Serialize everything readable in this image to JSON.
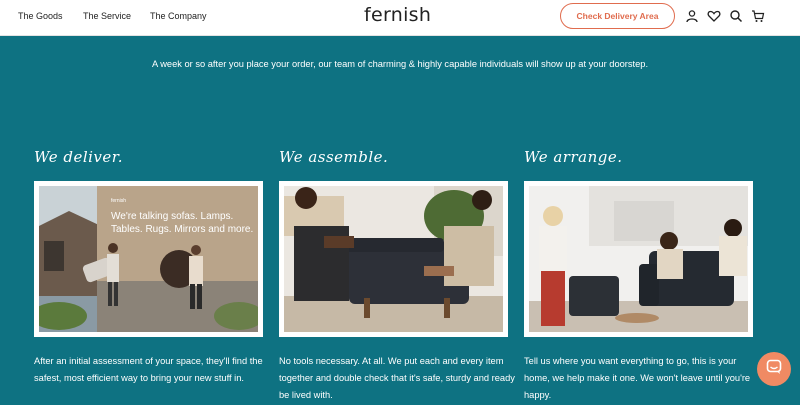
{
  "header": {
    "nav": [
      "The Goods",
      "The Service",
      "The Company"
    ],
    "logo": "fernish",
    "cta_label": "Check Delivery Area",
    "icons": [
      "account-icon",
      "heart-icon",
      "search-icon",
      "cart-icon"
    ]
  },
  "intro": {
    "text": "A week or so after you place your order, our team of charming & highly capable individuals will show up at your doorstep."
  },
  "columns": [
    {
      "title": "We deliver.",
      "body": "After an initial assessment of your space, they'll find the safest, most efficient way to bring your new stuff in.",
      "photo_caption_lines": [
        "We're talking sofas. Lamps.",
        "Tables. Rugs. Mirrors and more."
      ],
      "photo_brand": "fernish"
    },
    {
      "title": "We assemble.",
      "body": "No tools necessary. At all. We put each and every item together and double check that it's safe, sturdy and ready be lived with."
    },
    {
      "title": "We arrange.",
      "body": "Tell us where you want everything to go, this is your home, we help make it one. We won't leave until you're happy."
    }
  ],
  "colors": {
    "background": "#0e7282",
    "accent": "#e06c4e",
    "chat": "#f08a63"
  }
}
